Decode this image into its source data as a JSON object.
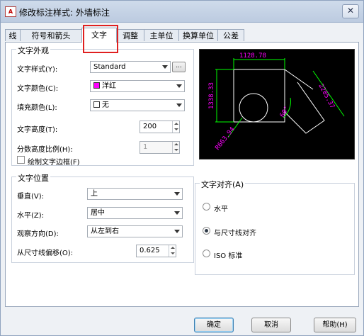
{
  "window": {
    "title": "修改标注样式: 外墙标注",
    "app_icon": "A",
    "close_glyph": "✕"
  },
  "tabs": [
    "线",
    "符号和箭头",
    "文字",
    "调整",
    "主单位",
    "换算单位",
    "公差"
  ],
  "active_tab": "文字",
  "appearance": {
    "title": "文字外观",
    "style_label": "文字样式(Y):",
    "style_value": "Standard",
    "browse_label": "...",
    "color_label": "文字颜色(C):",
    "color_value": "洋红",
    "color_hex": "#ff00ff",
    "fill_label": "填充颜色(L):",
    "fill_value": "无",
    "height_label": "文字高度(T):",
    "height_value": "200",
    "fraction_label": "分数高度比例(H):",
    "fraction_value": "1",
    "frame_label": "绘制文字边框(F)"
  },
  "placement": {
    "title": "文字位置",
    "vertical_label": "垂直(V):",
    "vertical_value": "上",
    "horizontal_label": "水平(Z):",
    "horizontal_value": "居中",
    "view_label": "观察方向(D):",
    "view_value": "从左到右",
    "offset_label": "从尺寸线偏移(O):",
    "offset_value": "0.625"
  },
  "alignment": {
    "title": "文字对齐(A)",
    "options": [
      "水平",
      "与尺寸线对齐",
      "ISO 标准"
    ],
    "selected": 1
  },
  "preview": {
    "dims": [
      "1128.78",
      "1338.33",
      "2205.37",
      "R663.94",
      "60°"
    ],
    "text_color": "#ff00ff",
    "line_color": "#ffffff",
    "dim_line_color": "#00ff00"
  },
  "buttons": {
    "ok": "确定",
    "cancel": "取消",
    "help": "帮助(H)"
  }
}
